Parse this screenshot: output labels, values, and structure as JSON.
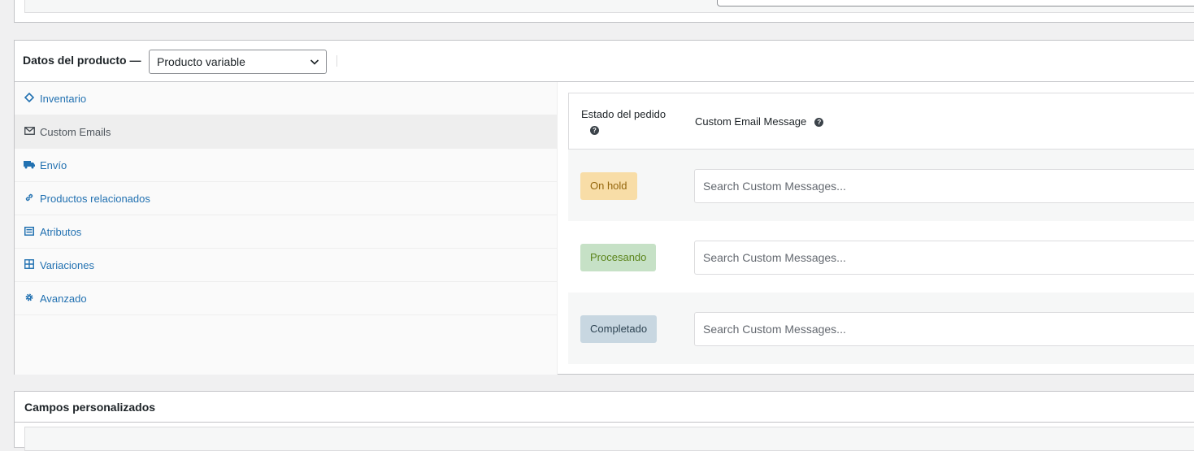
{
  "product_data": {
    "title": "Datos del producto —",
    "type_select": {
      "value": "Producto variable",
      "icon": "chevron-down-icon"
    },
    "tabs": [
      {
        "label": "Inventario",
        "icon": "tag-icon",
        "active": false
      },
      {
        "label": "Custom Emails",
        "icon": "envelope-icon",
        "active": true
      },
      {
        "label": "Envío",
        "icon": "truck-icon",
        "active": false
      },
      {
        "label": "Productos relacionados",
        "icon": "link-icon",
        "active": false
      },
      {
        "label": "Atributos",
        "icon": "list-icon",
        "active": false
      },
      {
        "label": "Variaciones",
        "icon": "grid-icon",
        "active": false
      },
      {
        "label": "Avanzado",
        "icon": "gear-icon",
        "active": false
      }
    ],
    "custom_emails": {
      "header": {
        "status_label": "Estado del pedido",
        "message_label": "Custom Email Message",
        "help_icon": "question-circle-icon"
      },
      "rows": [
        {
          "status": "On hold",
          "badge_bg": "#f8dda7",
          "badge_color": "#94660c",
          "placeholder": "Search Custom Messages...",
          "value": ""
        },
        {
          "status": "Procesando",
          "badge_bg": "#c6e1c6",
          "badge_color": "#5b841b",
          "placeholder": "Search Custom Messages...",
          "value": ""
        },
        {
          "status": "Completado",
          "badge_bg": "#c8d7e1",
          "badge_color": "#2e4453",
          "placeholder": "Search Custom Messages...",
          "value": ""
        }
      ]
    }
  },
  "custom_fields": {
    "title": "Campos personalizados"
  },
  "colors": {
    "link": "#2271b1",
    "border": "#c3c4c7",
    "background": "#f0f0f1"
  }
}
